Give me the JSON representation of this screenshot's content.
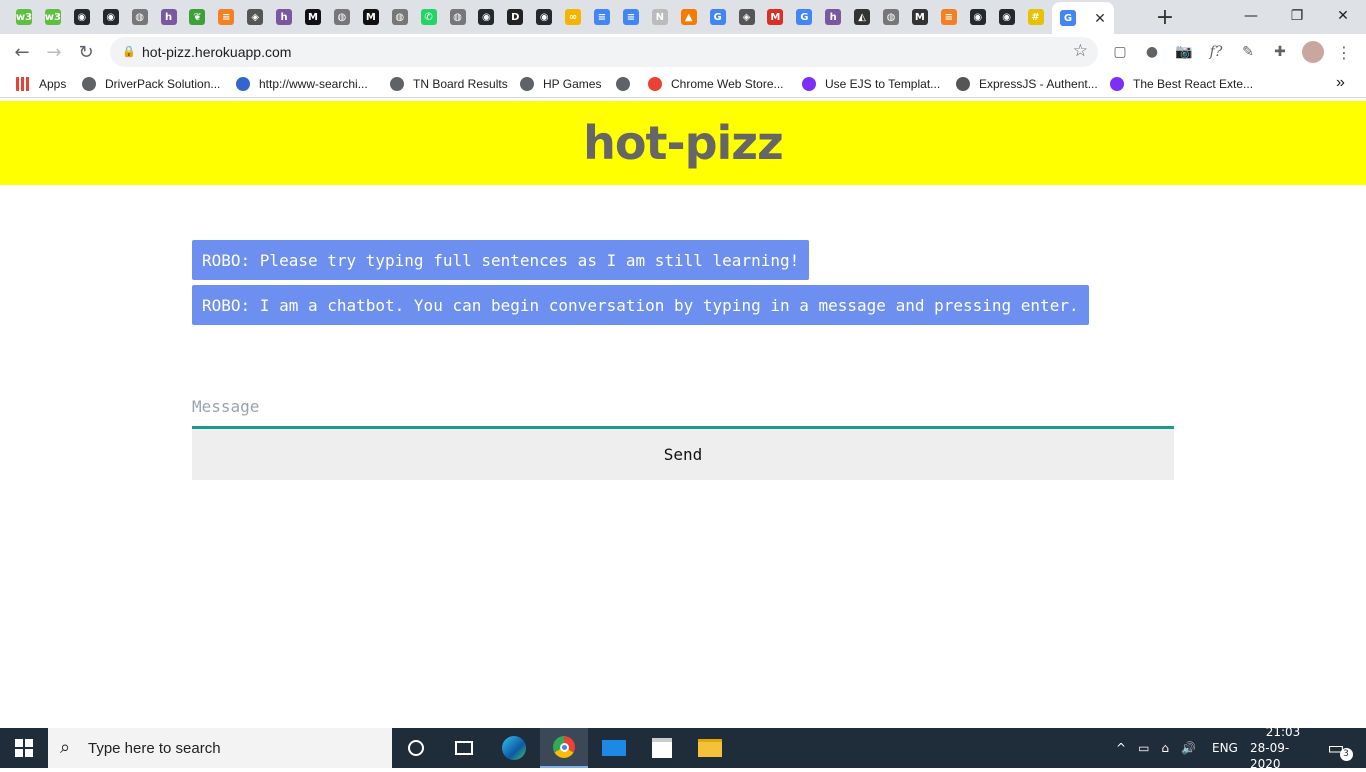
{
  "browser": {
    "tabs": [
      {
        "icon": "w3schools-icon",
        "color": "#5fbf3f",
        "glyph": "w3"
      },
      {
        "icon": "w3schools-icon",
        "color": "#5fbf3f",
        "glyph": "w3"
      },
      {
        "icon": "github-icon",
        "color": "#24292e",
        "glyph": "◉"
      },
      {
        "icon": "github-icon",
        "color": "#24292e",
        "glyph": "◉"
      },
      {
        "icon": "globe-icon",
        "color": "#777777",
        "glyph": "◍"
      },
      {
        "icon": "heroku-icon",
        "color": "#79589f",
        "glyph": "h"
      },
      {
        "icon": "mongodb-icon",
        "color": "#3fa037",
        "glyph": "❦"
      },
      {
        "icon": "stackoverflow-icon",
        "color": "#f48024",
        "glyph": "≡"
      },
      {
        "icon": "diamond-icon",
        "color": "#555555",
        "glyph": "◈"
      },
      {
        "icon": "heroku-icon",
        "color": "#79589f",
        "glyph": "h"
      },
      {
        "icon": "medium-icon",
        "color": "#111111",
        "glyph": "M"
      },
      {
        "icon": "globe-icon",
        "color": "#777777",
        "glyph": "◍"
      },
      {
        "icon": "medium-icon",
        "color": "#111111",
        "glyph": "M"
      },
      {
        "icon": "globe-icon",
        "color": "#777777",
        "glyph": "◍"
      },
      {
        "icon": "whatsapp-icon",
        "color": "#25d366",
        "glyph": "✆"
      },
      {
        "icon": "globe-icon",
        "color": "#777777",
        "glyph": "◍"
      },
      {
        "icon": "github-icon",
        "color": "#24292e",
        "glyph": "◉"
      },
      {
        "icon": "dev-icon",
        "color": "#222222",
        "glyph": "D"
      },
      {
        "icon": "github-icon",
        "color": "#24292e",
        "glyph": "◉"
      },
      {
        "icon": "codepen-icon",
        "color": "#f4b400",
        "glyph": "∞"
      },
      {
        "icon": "docs-icon",
        "color": "#4285f4",
        "glyph": "≡"
      },
      {
        "icon": "docs-icon",
        "color": "#4285f4",
        "glyph": "≡"
      },
      {
        "icon": "netlify-icon",
        "color": "#bbbbbb",
        "glyph": "N"
      },
      {
        "icon": "app-icon",
        "color": "#f57c00",
        "glyph": "▲"
      },
      {
        "icon": "google-icon",
        "color": "#4285f4",
        "glyph": "G"
      },
      {
        "icon": "diamond-icon",
        "color": "#555555",
        "glyph": "◈"
      },
      {
        "icon": "gmail-icon",
        "color": "#d93025",
        "glyph": "M"
      },
      {
        "icon": "google-icon",
        "color": "#4285f4",
        "glyph": "G"
      },
      {
        "icon": "heroku-icon",
        "color": "#79589f",
        "glyph": "h"
      },
      {
        "icon": "app-icon",
        "color": "#333333",
        "glyph": "◭"
      },
      {
        "icon": "globe-icon",
        "color": "#777777",
        "glyph": "◍"
      },
      {
        "icon": "medium-icon",
        "color": "#333333",
        "glyph": "M"
      },
      {
        "icon": "stackoverflow-icon",
        "color": "#f48024",
        "glyph": "≡"
      },
      {
        "icon": "github-icon",
        "color": "#24292e",
        "glyph": "◉"
      },
      {
        "icon": "github-icon",
        "color": "#24292e",
        "glyph": "◉"
      },
      {
        "icon": "notes-icon",
        "color": "#e6c200",
        "glyph": "#"
      },
      {
        "icon": "loading-icon",
        "color": "#e56b6f",
        "glyph": "✲"
      }
    ],
    "active_tab": {
      "icon": "google-icon",
      "color": "#4285f4",
      "glyph": "G"
    },
    "close_glyph": "✕",
    "new_tab_glyph": "+",
    "window_controls": {
      "minimize": "—",
      "restore": "❐",
      "close": "✕"
    },
    "url": "hot-pizz.herokuapp.com",
    "lock_glyph": "🔒",
    "star_glyph": "☆",
    "nav": {
      "back": "←",
      "forward": "→",
      "reload": "↻"
    },
    "extensions": [
      "▢",
      "●",
      "📷",
      "f?",
      "✎",
      "✚"
    ],
    "bookmarks": [
      {
        "label": "Apps",
        "icon": "apps-grid-icon",
        "color": "#e94235"
      },
      {
        "label": "DriverPack Solution...",
        "icon": "globe-icon",
        "color": "#5f6368"
      },
      {
        "label": "http://www-searchi...",
        "icon": "search-icon",
        "color": "#3366cc"
      },
      {
        "label": "TN Board Results",
        "icon": "globe-icon",
        "color": "#5f6368"
      },
      {
        "label": "HP Games",
        "icon": "globe-icon",
        "color": "#5f6368"
      },
      {
        "label": "",
        "icon": "globe-icon",
        "color": "#5f6368"
      },
      {
        "label": "Chrome Web Store...",
        "icon": "chrome-store-icon",
        "color": "#e94235"
      },
      {
        "label": "Use EJS to Templat...",
        "icon": "bookmark-icon",
        "color": "#7b2ff7"
      },
      {
        "label": "ExpressJS - Authent...",
        "icon": "diamond-icon",
        "color": "#555555"
      },
      {
        "label": "The Best React Exte...",
        "icon": "bookmark-icon",
        "color": "#7b2ff7"
      }
    ],
    "more_glyph": "»"
  },
  "app": {
    "title": "hot-pizz",
    "messages": [
      "ROBO: Please try typing full sentences as I am still learning!",
      "ROBO: I am a chatbot. You can begin conversation by typing in a message and pressing enter."
    ],
    "input": {
      "placeholder": "Message",
      "value": ""
    },
    "send_label": "Send",
    "colors": {
      "banner": "#ffff00",
      "bubble": "#6c8ff0",
      "accent": "#1a9a8a"
    }
  },
  "taskbar": {
    "search_placeholder": "Type here to search",
    "language": "ENG",
    "time": "21:03",
    "date": "28-09-2020",
    "notification_count": "3",
    "tray_icons": [
      "^",
      "▭",
      "⌂",
      "🔊"
    ]
  }
}
